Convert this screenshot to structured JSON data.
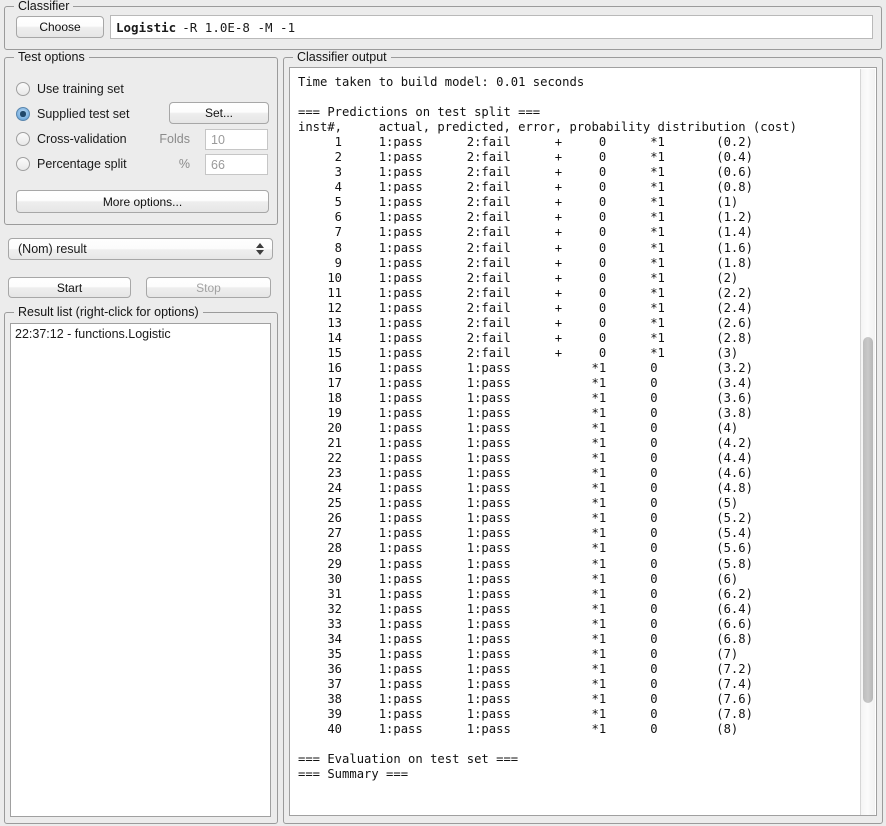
{
  "classifier": {
    "legend": "Classifier",
    "choose_label": "Choose",
    "name": "Logistic",
    "options": "-R 1.0E-8 -M -1"
  },
  "test_options": {
    "legend": "Test options",
    "items": [
      {
        "label": "Use training set",
        "checked": false,
        "enabled": true
      },
      {
        "label": "Supplied test set",
        "checked": true,
        "enabled": true
      },
      {
        "label": "Cross-validation",
        "checked": false,
        "enabled": true
      },
      {
        "label": "Percentage split",
        "checked": false,
        "enabled": true
      }
    ],
    "set_label": "Set...",
    "folds_label": "Folds",
    "folds_value": "10",
    "percent_label": "%",
    "percent_value": "66",
    "more_options_label": "More options..."
  },
  "class_select": {
    "selected": "(Nom) result"
  },
  "actions": {
    "start_label": "Start",
    "stop_label": "Stop"
  },
  "result_list": {
    "legend": "Result list (right-click for options)",
    "items": [
      "22:37:12 - functions.Logistic"
    ]
  },
  "classifier_output": {
    "legend": "Classifier output",
    "text": "Time taken to build model: 0.01 seconds\n\n=== Predictions on test split ===\ninst#,     actual, predicted, error, probability distribution (cost)\n     1     1:pass      2:fail      +     0      *1       (0.2)\n     2     1:pass      2:fail      +     0      *1       (0.4)\n     3     1:pass      2:fail      +     0      *1       (0.6)\n     4     1:pass      2:fail      +     0      *1       (0.8)\n     5     1:pass      2:fail      +     0      *1       (1)\n     6     1:pass      2:fail      +     0      *1       (1.2)\n     7     1:pass      2:fail      +     0      *1       (1.4)\n     8     1:pass      2:fail      +     0      *1       (1.6)\n     9     1:pass      2:fail      +     0      *1       (1.8)\n    10     1:pass      2:fail      +     0      *1       (2)\n    11     1:pass      2:fail      +     0      *1       (2.2)\n    12     1:pass      2:fail      +     0      *1       (2.4)\n    13     1:pass      2:fail      +     0      *1       (2.6)\n    14     1:pass      2:fail      +     0      *1       (2.8)\n    15     1:pass      2:fail      +     0      *1       (3)\n    16     1:pass      1:pass           *1      0        (3.2)\n    17     1:pass      1:pass           *1      0        (3.4)\n    18     1:pass      1:pass           *1      0        (3.6)\n    19     1:pass      1:pass           *1      0        (3.8)\n    20     1:pass      1:pass           *1      0        (4)\n    21     1:pass      1:pass           *1      0        (4.2)\n    22     1:pass      1:pass           *1      0        (4.4)\n    23     1:pass      1:pass           *1      0        (4.6)\n    24     1:pass      1:pass           *1      0        (4.8)\n    25     1:pass      1:pass           *1      0        (5)\n    26     1:pass      1:pass           *1      0        (5.2)\n    27     1:pass      1:pass           *1      0        (5.4)\n    28     1:pass      1:pass           *1      0        (5.6)\n    29     1:pass      1:pass           *1      0        (5.8)\n    30     1:pass      1:pass           *1      0        (6)\n    31     1:pass      1:pass           *1      0        (6.2)\n    32     1:pass      1:pass           *1      0        (6.4)\n    33     1:pass      1:pass           *1      0        (6.6)\n    34     1:pass      1:pass           *1      0        (6.8)\n    35     1:pass      1:pass           *1      0        (7)\n    36     1:pass      1:pass           *1      0        (7.2)\n    37     1:pass      1:pass           *1      0        (7.4)\n    38     1:pass      1:pass           *1      0        (7.6)\n    39     1:pass      1:pass           *1      0        (7.8)\n    40     1:pass      1:pass           *1      0        (8)\n\n=== Evaluation on test set ===\n=== Summary ==="
  }
}
